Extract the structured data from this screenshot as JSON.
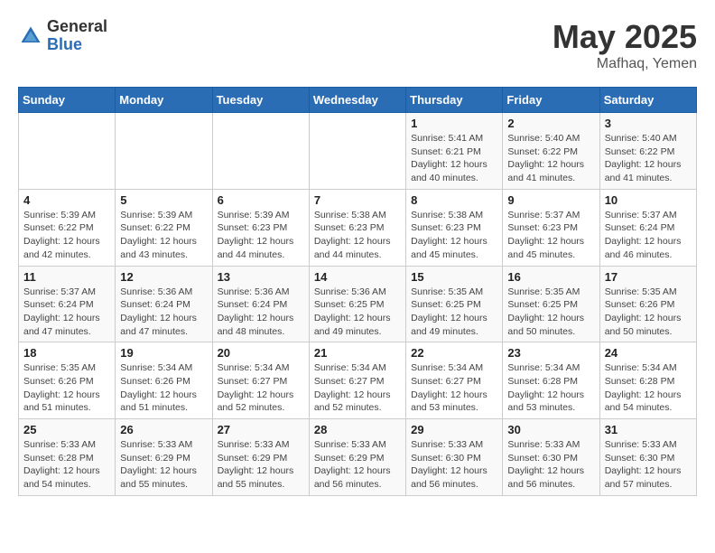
{
  "header": {
    "logo_general": "General",
    "logo_blue": "Blue",
    "month_year": "May 2025",
    "location": "Mafhaq, Yemen"
  },
  "days_of_week": [
    "Sunday",
    "Monday",
    "Tuesday",
    "Wednesday",
    "Thursday",
    "Friday",
    "Saturday"
  ],
  "weeks": [
    [
      {
        "day": "",
        "info": ""
      },
      {
        "day": "",
        "info": ""
      },
      {
        "day": "",
        "info": ""
      },
      {
        "day": "",
        "info": ""
      },
      {
        "day": "1",
        "info": "Sunrise: 5:41 AM\nSunset: 6:21 PM\nDaylight: 12 hours and 40 minutes."
      },
      {
        "day": "2",
        "info": "Sunrise: 5:40 AM\nSunset: 6:22 PM\nDaylight: 12 hours and 41 minutes."
      },
      {
        "day": "3",
        "info": "Sunrise: 5:40 AM\nSunset: 6:22 PM\nDaylight: 12 hours and 41 minutes."
      }
    ],
    [
      {
        "day": "4",
        "info": "Sunrise: 5:39 AM\nSunset: 6:22 PM\nDaylight: 12 hours and 42 minutes."
      },
      {
        "day": "5",
        "info": "Sunrise: 5:39 AM\nSunset: 6:22 PM\nDaylight: 12 hours and 43 minutes."
      },
      {
        "day": "6",
        "info": "Sunrise: 5:39 AM\nSunset: 6:23 PM\nDaylight: 12 hours and 44 minutes."
      },
      {
        "day": "7",
        "info": "Sunrise: 5:38 AM\nSunset: 6:23 PM\nDaylight: 12 hours and 44 minutes."
      },
      {
        "day": "8",
        "info": "Sunrise: 5:38 AM\nSunset: 6:23 PM\nDaylight: 12 hours and 45 minutes."
      },
      {
        "day": "9",
        "info": "Sunrise: 5:37 AM\nSunset: 6:23 PM\nDaylight: 12 hours and 45 minutes."
      },
      {
        "day": "10",
        "info": "Sunrise: 5:37 AM\nSunset: 6:24 PM\nDaylight: 12 hours and 46 minutes."
      }
    ],
    [
      {
        "day": "11",
        "info": "Sunrise: 5:37 AM\nSunset: 6:24 PM\nDaylight: 12 hours and 47 minutes."
      },
      {
        "day": "12",
        "info": "Sunrise: 5:36 AM\nSunset: 6:24 PM\nDaylight: 12 hours and 47 minutes."
      },
      {
        "day": "13",
        "info": "Sunrise: 5:36 AM\nSunset: 6:24 PM\nDaylight: 12 hours and 48 minutes."
      },
      {
        "day": "14",
        "info": "Sunrise: 5:36 AM\nSunset: 6:25 PM\nDaylight: 12 hours and 49 minutes."
      },
      {
        "day": "15",
        "info": "Sunrise: 5:35 AM\nSunset: 6:25 PM\nDaylight: 12 hours and 49 minutes."
      },
      {
        "day": "16",
        "info": "Sunrise: 5:35 AM\nSunset: 6:25 PM\nDaylight: 12 hours and 50 minutes."
      },
      {
        "day": "17",
        "info": "Sunrise: 5:35 AM\nSunset: 6:26 PM\nDaylight: 12 hours and 50 minutes."
      }
    ],
    [
      {
        "day": "18",
        "info": "Sunrise: 5:35 AM\nSunset: 6:26 PM\nDaylight: 12 hours and 51 minutes."
      },
      {
        "day": "19",
        "info": "Sunrise: 5:34 AM\nSunset: 6:26 PM\nDaylight: 12 hours and 51 minutes."
      },
      {
        "day": "20",
        "info": "Sunrise: 5:34 AM\nSunset: 6:27 PM\nDaylight: 12 hours and 52 minutes."
      },
      {
        "day": "21",
        "info": "Sunrise: 5:34 AM\nSunset: 6:27 PM\nDaylight: 12 hours and 52 minutes."
      },
      {
        "day": "22",
        "info": "Sunrise: 5:34 AM\nSunset: 6:27 PM\nDaylight: 12 hours and 53 minutes."
      },
      {
        "day": "23",
        "info": "Sunrise: 5:34 AM\nSunset: 6:28 PM\nDaylight: 12 hours and 53 minutes."
      },
      {
        "day": "24",
        "info": "Sunrise: 5:34 AM\nSunset: 6:28 PM\nDaylight: 12 hours and 54 minutes."
      }
    ],
    [
      {
        "day": "25",
        "info": "Sunrise: 5:33 AM\nSunset: 6:28 PM\nDaylight: 12 hours and 54 minutes."
      },
      {
        "day": "26",
        "info": "Sunrise: 5:33 AM\nSunset: 6:29 PM\nDaylight: 12 hours and 55 minutes."
      },
      {
        "day": "27",
        "info": "Sunrise: 5:33 AM\nSunset: 6:29 PM\nDaylight: 12 hours and 55 minutes."
      },
      {
        "day": "28",
        "info": "Sunrise: 5:33 AM\nSunset: 6:29 PM\nDaylight: 12 hours and 56 minutes."
      },
      {
        "day": "29",
        "info": "Sunrise: 5:33 AM\nSunset: 6:30 PM\nDaylight: 12 hours and 56 minutes."
      },
      {
        "day": "30",
        "info": "Sunrise: 5:33 AM\nSunset: 6:30 PM\nDaylight: 12 hours and 56 minutes."
      },
      {
        "day": "31",
        "info": "Sunrise: 5:33 AM\nSunset: 6:30 PM\nDaylight: 12 hours and 57 minutes."
      }
    ]
  ]
}
